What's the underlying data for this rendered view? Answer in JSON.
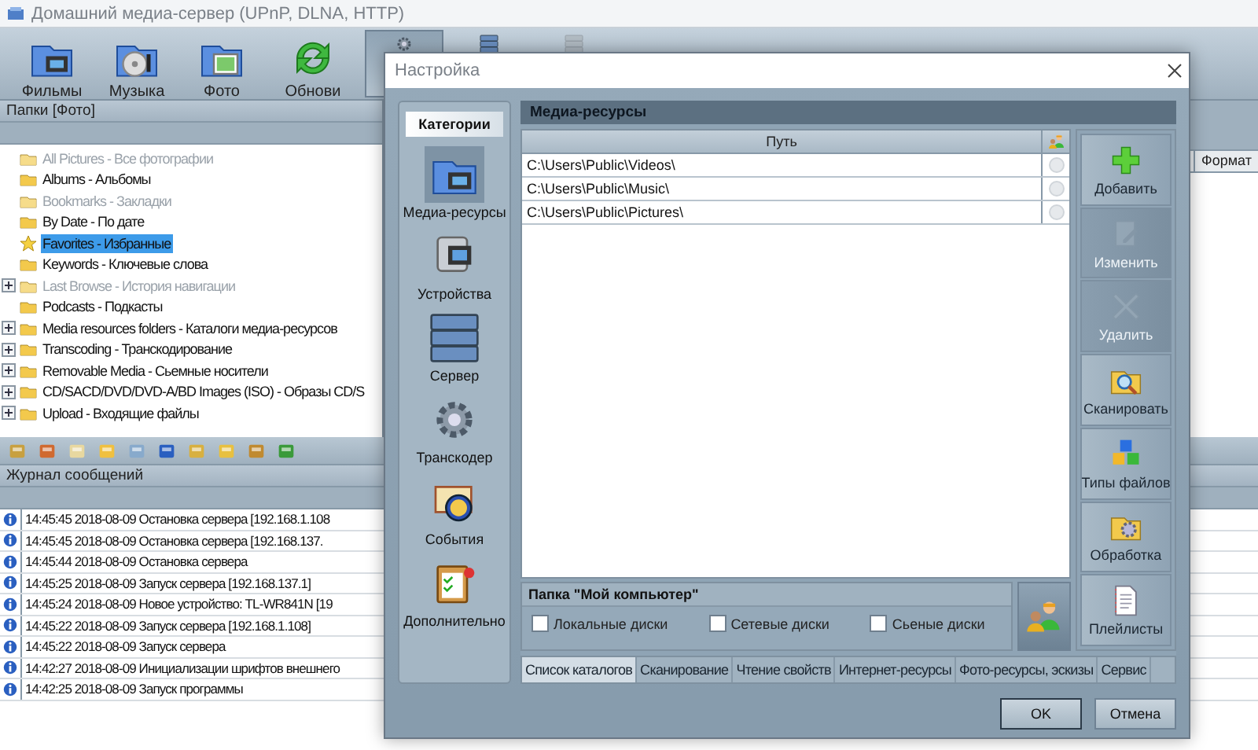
{
  "main_window": {
    "title": "Домашний медиа-сервер (UPnP, DLNA, HTTP)",
    "toolbar": [
      {
        "label": "Фильмы",
        "selected": false,
        "disabled": false
      },
      {
        "label": "Музыка",
        "selected": false,
        "disabled": false
      },
      {
        "label": "Фото",
        "selected": false,
        "disabled": false
      },
      {
        "label": "Обнови",
        "selected": false,
        "disabled": false
      },
      {
        "selected": true,
        "disabled": false
      },
      {
        "selected": false,
        "disabled": false
      },
      {
        "selected": false,
        "disabled": true
      }
    ]
  },
  "folders_panel": {
    "title": "Папки [Фото]",
    "items": [
      {
        "label": "All Pictures - Все фотографии",
        "dimmed": true,
        "expander": false,
        "selected": false
      },
      {
        "label": "Albums - Альбомы",
        "dimmed": false,
        "expander": false,
        "selected": false
      },
      {
        "label": "Bookmarks - Закладки",
        "dimmed": true,
        "expander": false,
        "selected": false
      },
      {
        "label": "By Date - По дате",
        "dimmed": false,
        "expander": false,
        "selected": false
      },
      {
        "label": "Favorites - Избранные",
        "dimmed": false,
        "expander": false,
        "selected": true
      },
      {
        "label": "Keywords - Ключевые слова",
        "dimmed": false,
        "expander": false,
        "selected": false
      },
      {
        "label": "Last Browse - История навигации",
        "dimmed": true,
        "expander": true,
        "selected": false
      },
      {
        "label": "Podcasts - Подкасты",
        "dimmed": false,
        "expander": false,
        "selected": false
      },
      {
        "label": "Media resources folders - Каталоги медиа-ресурсов",
        "dimmed": false,
        "expander": true,
        "selected": false
      },
      {
        "label": "Transcoding - Транскодирование",
        "dimmed": false,
        "expander": true,
        "selected": false
      },
      {
        "label": "Removable Media - Сьемные носители",
        "dimmed": false,
        "expander": true,
        "selected": false
      },
      {
        "label": "CD/SACD/DVD/DVD-A/BD Images (ISO) - Образы CD/S",
        "dimmed": false,
        "expander": true,
        "selected": false
      },
      {
        "label": "Upload - Входящие файлы",
        "dimmed": false,
        "expander": true,
        "selected": false
      }
    ]
  },
  "file_list": {
    "column_header": "Формат"
  },
  "log": {
    "title": "Журнал сообщений",
    "entries": [
      "14:45:45 2018-08-09 Остановка сервера [192.168.1.108",
      "14:45:45 2018-08-09 Остановка сервера [192.168.137.",
      "14:45:44 2018-08-09 Остановка сервера",
      "14:45:25 2018-08-09 Запуск сервера [192.168.137.1]",
      "14:45:24 2018-08-09 Новое устройство: TL-WR841N [19",
      "14:45:22 2018-08-09 Запуск сервера [192.168.1.108]",
      "14:45:22 2018-08-09 Запуск сервера",
      "14:42:27 2018-08-09 Инициализации шрифтов внешнего",
      "14:42:25 2018-08-09 Запуск программы"
    ]
  },
  "dialog": {
    "title": "Настройка",
    "categories_title": "Категории",
    "categories": [
      {
        "label": "Медиа-ресурсы",
        "selected": true
      },
      {
        "label": "Устройства",
        "selected": false
      },
      {
        "label": "Сервер",
        "selected": false
      },
      {
        "label": "Транскодер",
        "selected": false
      },
      {
        "label": "События",
        "selected": false
      },
      {
        "label": "Дополнительно",
        "selected": false
      }
    ],
    "section_title": "Медиа-ресурсы",
    "table": {
      "columns": [
        "Путь"
      ],
      "rows": [
        "C:\\Users\\Public\\Videos\\",
        "C:\\Users\\Public\\Music\\",
        "C:\\Users\\Public\\Pictures\\"
      ]
    },
    "actions": [
      {
        "label": "Добавить",
        "disabled": false
      },
      {
        "label": "Изменить",
        "disabled": true
      },
      {
        "label": "Удалить",
        "disabled": true
      },
      {
        "label": "Сканировать",
        "disabled": false
      },
      {
        "label": "Типы файлов",
        "disabled": false
      },
      {
        "label": "Обработка",
        "disabled": false
      },
      {
        "label": "Плейлисты",
        "disabled": false
      }
    ],
    "group": {
      "title": "Папка \"Мой компьютер\"",
      "options": [
        {
          "label": "Локальные диски",
          "checked": false
        },
        {
          "label": "Сетевые диски",
          "checked": false
        },
        {
          "label": "Сьеные диски",
          "checked": false
        }
      ]
    },
    "tabs": [
      {
        "label": "Список каталогов",
        "selected": true
      },
      {
        "label": "Сканирование",
        "selected": false
      },
      {
        "label": "Чтение свойств",
        "selected": false
      },
      {
        "label": "Интернет-ресурсы",
        "selected": false
      },
      {
        "label": "Фото-ресурсы, эскизы",
        "selected": false
      },
      {
        "label": "Сервис",
        "selected": false
      }
    ],
    "buttons": [
      "OK",
      "Отмена"
    ]
  }
}
